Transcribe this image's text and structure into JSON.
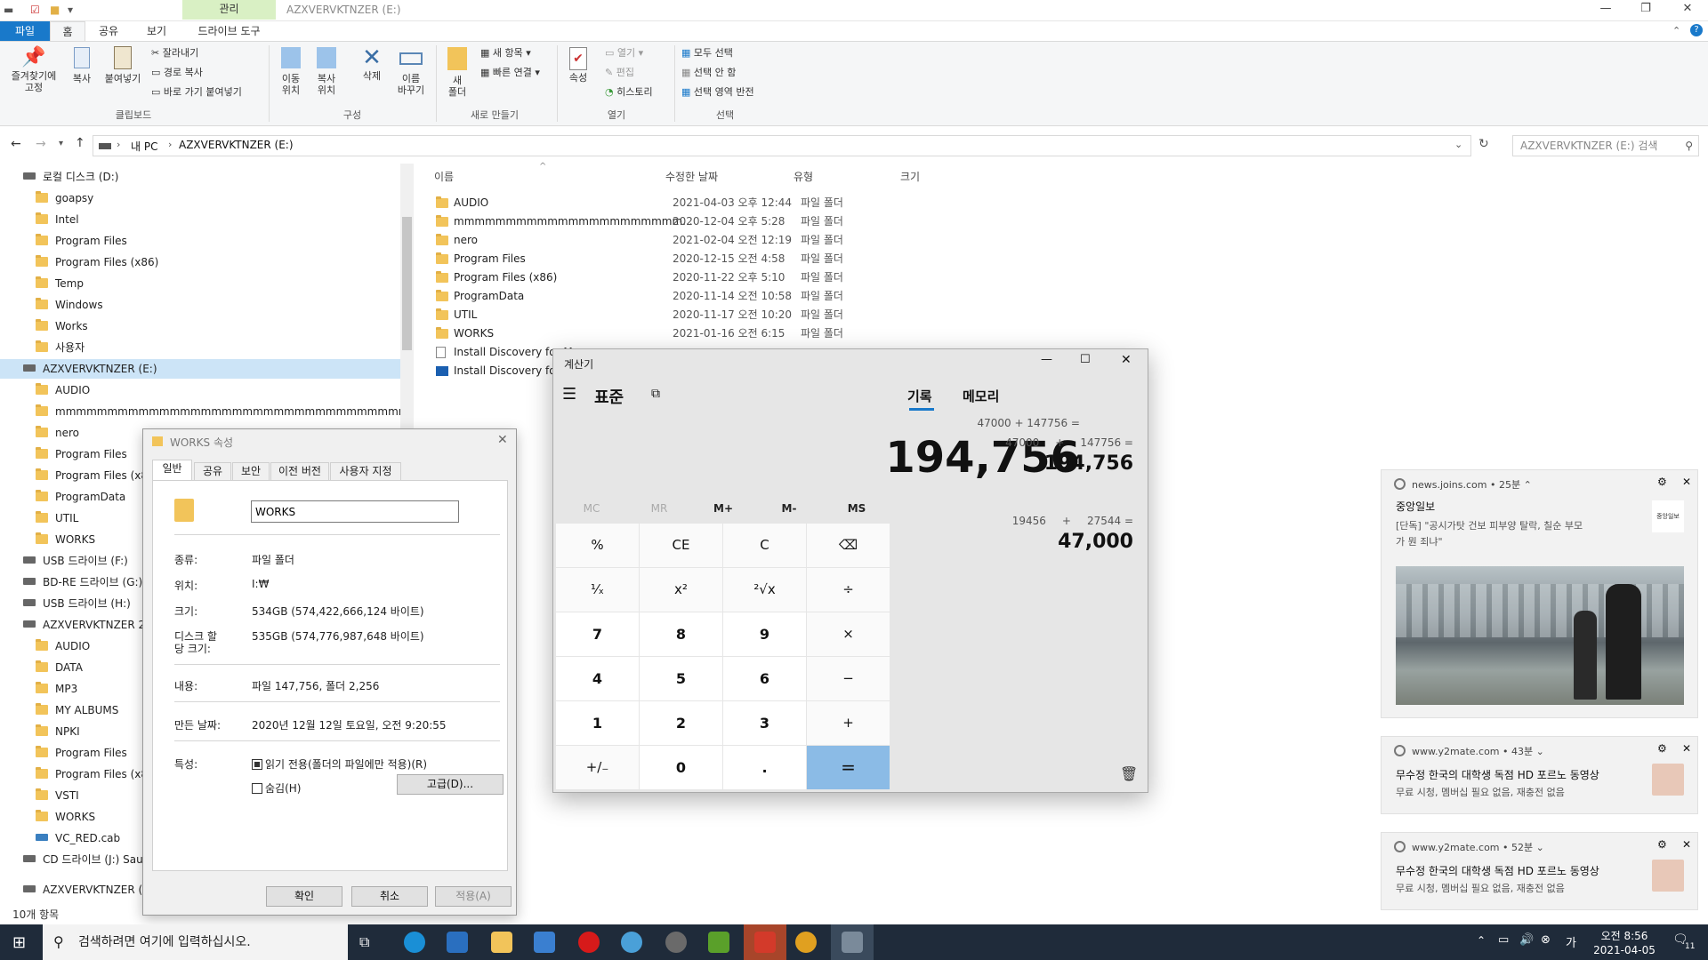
{
  "explorer": {
    "title": "AZXVERVKTNZER (E:)",
    "context_tab": "관리",
    "tabs": [
      "파일",
      "홈",
      "공유",
      "보기",
      "드라이브 도구"
    ],
    "ribbon": {
      "pin_label": "즐겨찾기에\n고정",
      "copy_label": "복사",
      "paste_label": "붙여넣기",
      "cut_label": "잘라내기",
      "copy_path_label": "경로 복사",
      "paste_shortcut_label": "바로 가기 붙여넣기",
      "clipboard_group": "클립보드",
      "move_label": "이동\n위치",
      "copyto_label": "복사\n위치",
      "delete_label": "삭제",
      "rename_label": "이름\n바꾸기",
      "organize_group": "구성",
      "new_folder_label": "새\n폴더",
      "new_item_label": "새 항목",
      "easy_access_label": "빠른 연결",
      "new_group": "새로 만들기",
      "properties_label": "속성",
      "open_label": "열기",
      "edit_label": "편집",
      "history_label": "히스토리",
      "open_group": "열기",
      "select_all_label": "모두 선택",
      "select_none_label": "선택 안 함",
      "invert_label": "선택 영역 반전",
      "select_group": "선택"
    },
    "address": {
      "pc": "내 PC",
      "drive": "AZXVERVKTNZER (E:)"
    },
    "search_placeholder": "AZXVERVKTNZER (E:) 검색",
    "nav": [
      {
        "label": "로컬 디스크 (D:)",
        "type": "drive",
        "indent": 0
      },
      {
        "label": "goapsy",
        "type": "folder",
        "indent": 1
      },
      {
        "label": "Intel",
        "type": "folder",
        "indent": 1
      },
      {
        "label": "Program Files",
        "type": "folder",
        "indent": 1
      },
      {
        "label": "Program Files (x86)",
        "type": "folder",
        "indent": 1
      },
      {
        "label": "Temp",
        "type": "folder",
        "indent": 1
      },
      {
        "label": "Windows",
        "type": "folder",
        "indent": 1
      },
      {
        "label": "Works",
        "type": "folder",
        "indent": 1
      },
      {
        "label": "사용자",
        "type": "folder",
        "indent": 1
      },
      {
        "label": "AZXVERVKTNZER (E:)",
        "type": "drive",
        "indent": 0,
        "selected": true
      },
      {
        "label": "AUDIO",
        "type": "folder",
        "indent": 1
      },
      {
        "label": "mmmmmmmmmmmmmmmmmmmmmmmmmmmmmmmmmmmmmmmmmmmmm",
        "type": "folder",
        "indent": 1
      },
      {
        "label": "nero",
        "type": "folder",
        "indent": 1
      },
      {
        "label": "Program Files",
        "type": "folder",
        "indent": 1
      },
      {
        "label": "Program Files (x86",
        "type": "folder",
        "indent": 1
      },
      {
        "label": "ProgramData",
        "type": "folder",
        "indent": 1
      },
      {
        "label": "UTIL",
        "type": "folder",
        "indent": 1
      },
      {
        "label": "WORKS",
        "type": "folder",
        "indent": 1
      },
      {
        "label": "USB 드라이브 (F:)",
        "type": "drive",
        "indent": 0
      },
      {
        "label": "BD-RE 드라이브 (G:)",
        "type": "drive",
        "indent": 0
      },
      {
        "label": "USB 드라이브 (H:)",
        "type": "drive",
        "indent": 0
      },
      {
        "label": "AZXVERVKTNZER 2",
        "type": "drive",
        "indent": 0
      },
      {
        "label": "AUDIO",
        "type": "folder",
        "indent": 1
      },
      {
        "label": "DATA",
        "type": "folder",
        "indent": 1
      },
      {
        "label": "MP3",
        "type": "folder",
        "indent": 1
      },
      {
        "label": "MY ALBUMS",
        "type": "folder",
        "indent": 1
      },
      {
        "label": "NPKI",
        "type": "folder",
        "indent": 1
      },
      {
        "label": "Program Files",
        "type": "folder",
        "indent": 1
      },
      {
        "label": "Program Files (x86",
        "type": "folder",
        "indent": 1
      },
      {
        "label": "VSTI",
        "type": "folder",
        "indent": 1
      },
      {
        "label": "WORKS",
        "type": "folder",
        "indent": 1
      },
      {
        "label": "VC_RED.cab",
        "type": "file",
        "indent": 1
      },
      {
        "label": "CD 드라이브 (J:) Sau",
        "type": "drive",
        "indent": 0
      }
    ],
    "nav_bottom": "AZXVERVKTNZER (E:)",
    "columns": [
      "이름",
      "수정한 날짜",
      "유형",
      "크기"
    ],
    "files": [
      {
        "name": "AUDIO",
        "date": "2021-04-03 오후 12:44",
        "type": "파일 폴더",
        "kind": "folder"
      },
      {
        "name": "mmmmmmmmmmmmmmmmmmmmmm...",
        "date": "2020-12-04 오후 5:28",
        "type": "파일 폴더",
        "kind": "folder"
      },
      {
        "name": "nero",
        "date": "2021-02-04 오전 12:19",
        "type": "파일 폴더",
        "kind": "folder"
      },
      {
        "name": "Program Files",
        "date": "2020-12-15 오전 4:58",
        "type": "파일 폴더",
        "kind": "folder"
      },
      {
        "name": "Program Files (x86)",
        "date": "2020-11-22 오후 5:10",
        "type": "파일 폴더",
        "kind": "folder"
      },
      {
        "name": "ProgramData",
        "date": "2020-11-14 오전 10:58",
        "type": "파일 폴더",
        "kind": "folder"
      },
      {
        "name": "UTIL",
        "date": "2020-11-17 오전 10:20",
        "type": "파일 폴더",
        "kind": "folder"
      },
      {
        "name": "WORKS",
        "date": "2021-01-16 오전 6:15",
        "type": "파일 폴더",
        "kind": "folder"
      },
      {
        "name": "Install Discovery for M",
        "date": "",
        "type": "",
        "kind": "file"
      },
      {
        "name": "Install Discovery for W",
        "date": "",
        "type": "",
        "kind": "wd"
      }
    ],
    "status": "10개 항목"
  },
  "properties": {
    "title": "WORKS 속성",
    "tabs": [
      "일반",
      "공유",
      "보안",
      "이전 버전",
      "사용자 지정"
    ],
    "name_value": "WORKS",
    "type_label": "종류:",
    "type_value": "파일 폴더",
    "location_label": "위치:",
    "location_value": "I:₩",
    "size_label": "크기:",
    "size_value": "534GB (574,422,666,124 바이트)",
    "disk_label_1": "디스크 할",
    "disk_label_2": "당 크기:",
    "disk_value": "535GB (574,776,987,648 바이트)",
    "contents_label": "내용:",
    "contents_value": "파일 147,756, 폴더 2,256",
    "created_label": "만든 날짜:",
    "created_value": "2020년 12월 12일 토요일, 오전 9:20:55",
    "attr_label": "특성:",
    "readonly_label": "읽기 전용(폴더의 파일에만 적용)(R)",
    "hidden_label": "숨김(H)",
    "advanced_button": "고급(D)...",
    "ok_button": "확인",
    "cancel_button": "취소",
    "apply_button": "적용(A)"
  },
  "calculator": {
    "title": "계산기",
    "mode": "표준",
    "expression": "47000 + 147756 =",
    "display": "194,756",
    "memory": [
      "MC",
      "MR",
      "M+",
      "M-",
      "MS"
    ],
    "keys": [
      [
        "%",
        "CE",
        "C",
        "⌫"
      ],
      [
        "¹⁄ₓ",
        "x²",
        "²√x",
        "÷"
      ],
      [
        "7",
        "8",
        "9",
        "×"
      ],
      [
        "4",
        "5",
        "6",
        "−"
      ],
      [
        "1",
        "2",
        "3",
        "+"
      ],
      [
        "+/₋",
        "0",
        ".",
        "="
      ]
    ],
    "history_tab": "기록",
    "memory_tab": "메모리",
    "history": [
      {
        "expr_a": "47000",
        "op": "+",
        "expr_b": "147756 =",
        "result": "194,756"
      },
      {
        "expr_a": "19456",
        "op": "+",
        "expr_b": "27544 =",
        "result": "47,000"
      }
    ]
  },
  "notifications": [
    {
      "source": "news.joins.com",
      "time": "25분",
      "headline": "중앙일보",
      "body1": "[단독] \"공시가탓 건보 피부양 탈락, 칠순 부모",
      "body2": "가 뭔 죄냐\"",
      "logo": "중앙일보"
    },
    {
      "source": "www.y2mate.com",
      "time": "43분",
      "headline": "무수정 한국의 대학생 독점 HD 포르노 동영상",
      "body1": "무료 시청, 멤버십 필요 없음, 재충전 없음"
    },
    {
      "source": "www.y2mate.com",
      "time": "52분",
      "headline": "무수정 한국의 대학생 독점 HD 포르노 동영상",
      "body1": "무료 시청, 멤버십 필요 없음, 재충전 없음"
    }
  ],
  "taskbar": {
    "search_placeholder": "검색하려면 여기에 입력하십시오.",
    "time": "오전 8:56",
    "date": "2021-04-05",
    "notif_count": "11"
  },
  "colors": {
    "accent": "#1979ca",
    "equals": "#8bbbe6",
    "taskbar": "#1f2b3a"
  }
}
